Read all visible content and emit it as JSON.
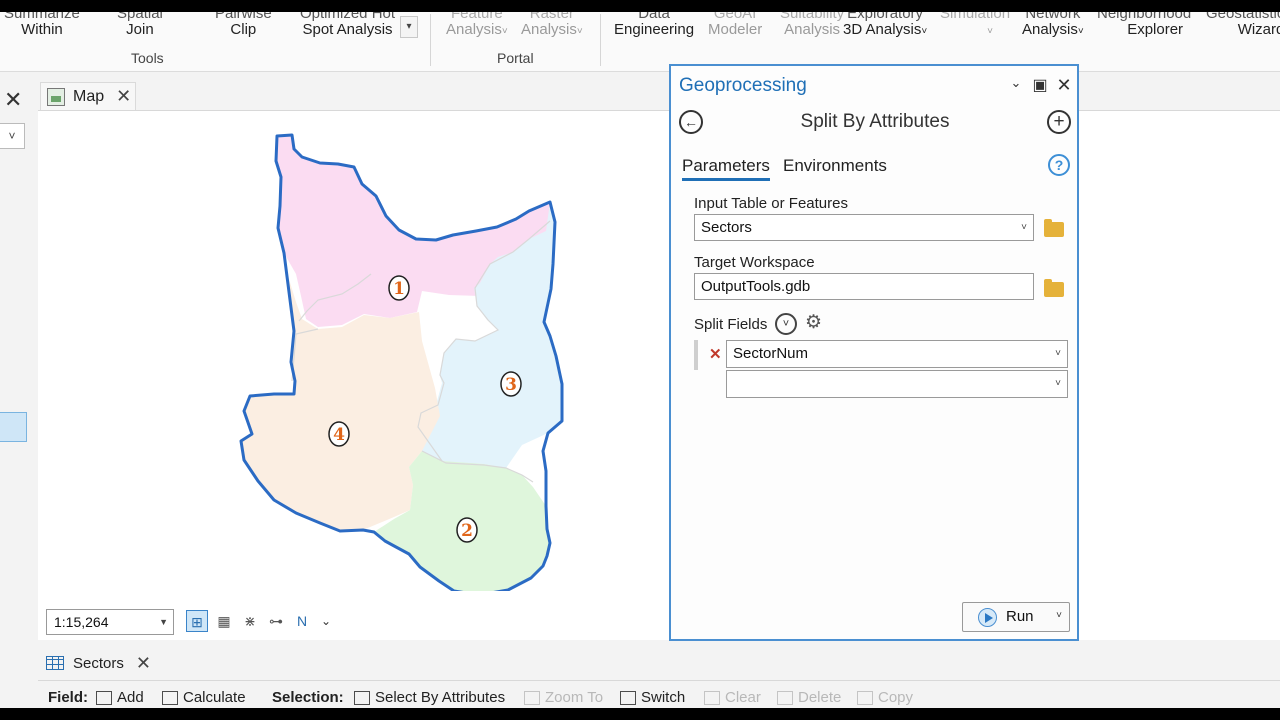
{
  "ribbon": {
    "tools_group_label": "Tools",
    "portal_group_label": "Portal",
    "summarize_within": {
      "top": "Summarize",
      "bottom": "Within"
    },
    "spatial_join": {
      "top": "Spatial",
      "bottom": "Join"
    },
    "pairwise_clip": {
      "top": "Pairwise",
      "bottom": "Clip"
    },
    "optimized_hot_spot": {
      "top": "Optimized Hot",
      "bottom": "Spot Analysis"
    },
    "feature_analysis": {
      "top": "Feature",
      "bottom": "Analysis"
    },
    "raster_analysis": {
      "top": "Raster",
      "bottom": "Analysis"
    },
    "data_engineering": {
      "top": "Data",
      "bottom": "Engineering"
    },
    "geoai_modeler": {
      "top": "GeoAI",
      "bottom": "Modeler"
    },
    "suitability_analysis": {
      "top": "Suitability",
      "bottom": "Analysis"
    },
    "exploratory_3d": {
      "top": "Exploratory",
      "bottom": "3D Analysis"
    },
    "simulation": {
      "top": "Simulation",
      "bottom": ""
    },
    "network_analysis": {
      "top": "Network",
      "bottom": "Analysis"
    },
    "neighborhood_explorer": {
      "top": "Neighborhood",
      "bottom": "Explorer"
    },
    "geostatistical_wizard": {
      "top": "Geostatistical",
      "bottom": "Wizard"
    }
  },
  "map_tab": {
    "label": "Map"
  },
  "map": {
    "scale": "1:15,264",
    "sector_labels": [
      "1",
      "2",
      "3",
      "4"
    ],
    "colors": {
      "sector1": "#fbdcf2",
      "sector2": "#dff6dc",
      "sector3": "#e3f3fb",
      "sector4": "#fbeee2",
      "outline": "#2b6bc4",
      "label_text": "#e0661a"
    }
  },
  "attribute_table": {
    "tab_label": "Sectors",
    "field_label": "Field:",
    "add_label": "Add",
    "calculate_label": "Calculate",
    "selection_label": "Selection:",
    "select_by_attributes_label": "Select By Attributes",
    "zoom_to_label": "Zoom To",
    "switch_label": "Switch",
    "clear_label": "Clear",
    "delete_label": "Delete",
    "copy_label": "Copy"
  },
  "geoprocessing": {
    "title": "Geoprocessing",
    "tool_name": "Split By Attributes",
    "tabs": {
      "parameters": "Parameters",
      "environments": "Environments"
    },
    "help_icon_text": "?",
    "input_label": "Input Table or Features",
    "input_value": "Sectors",
    "workspace_label": "Target Workspace",
    "workspace_value": "OutputTools.gdb",
    "split_fields_label": "Split Fields",
    "split_field_1": "SectorNum",
    "split_field_2": "",
    "run_label": "Run"
  }
}
